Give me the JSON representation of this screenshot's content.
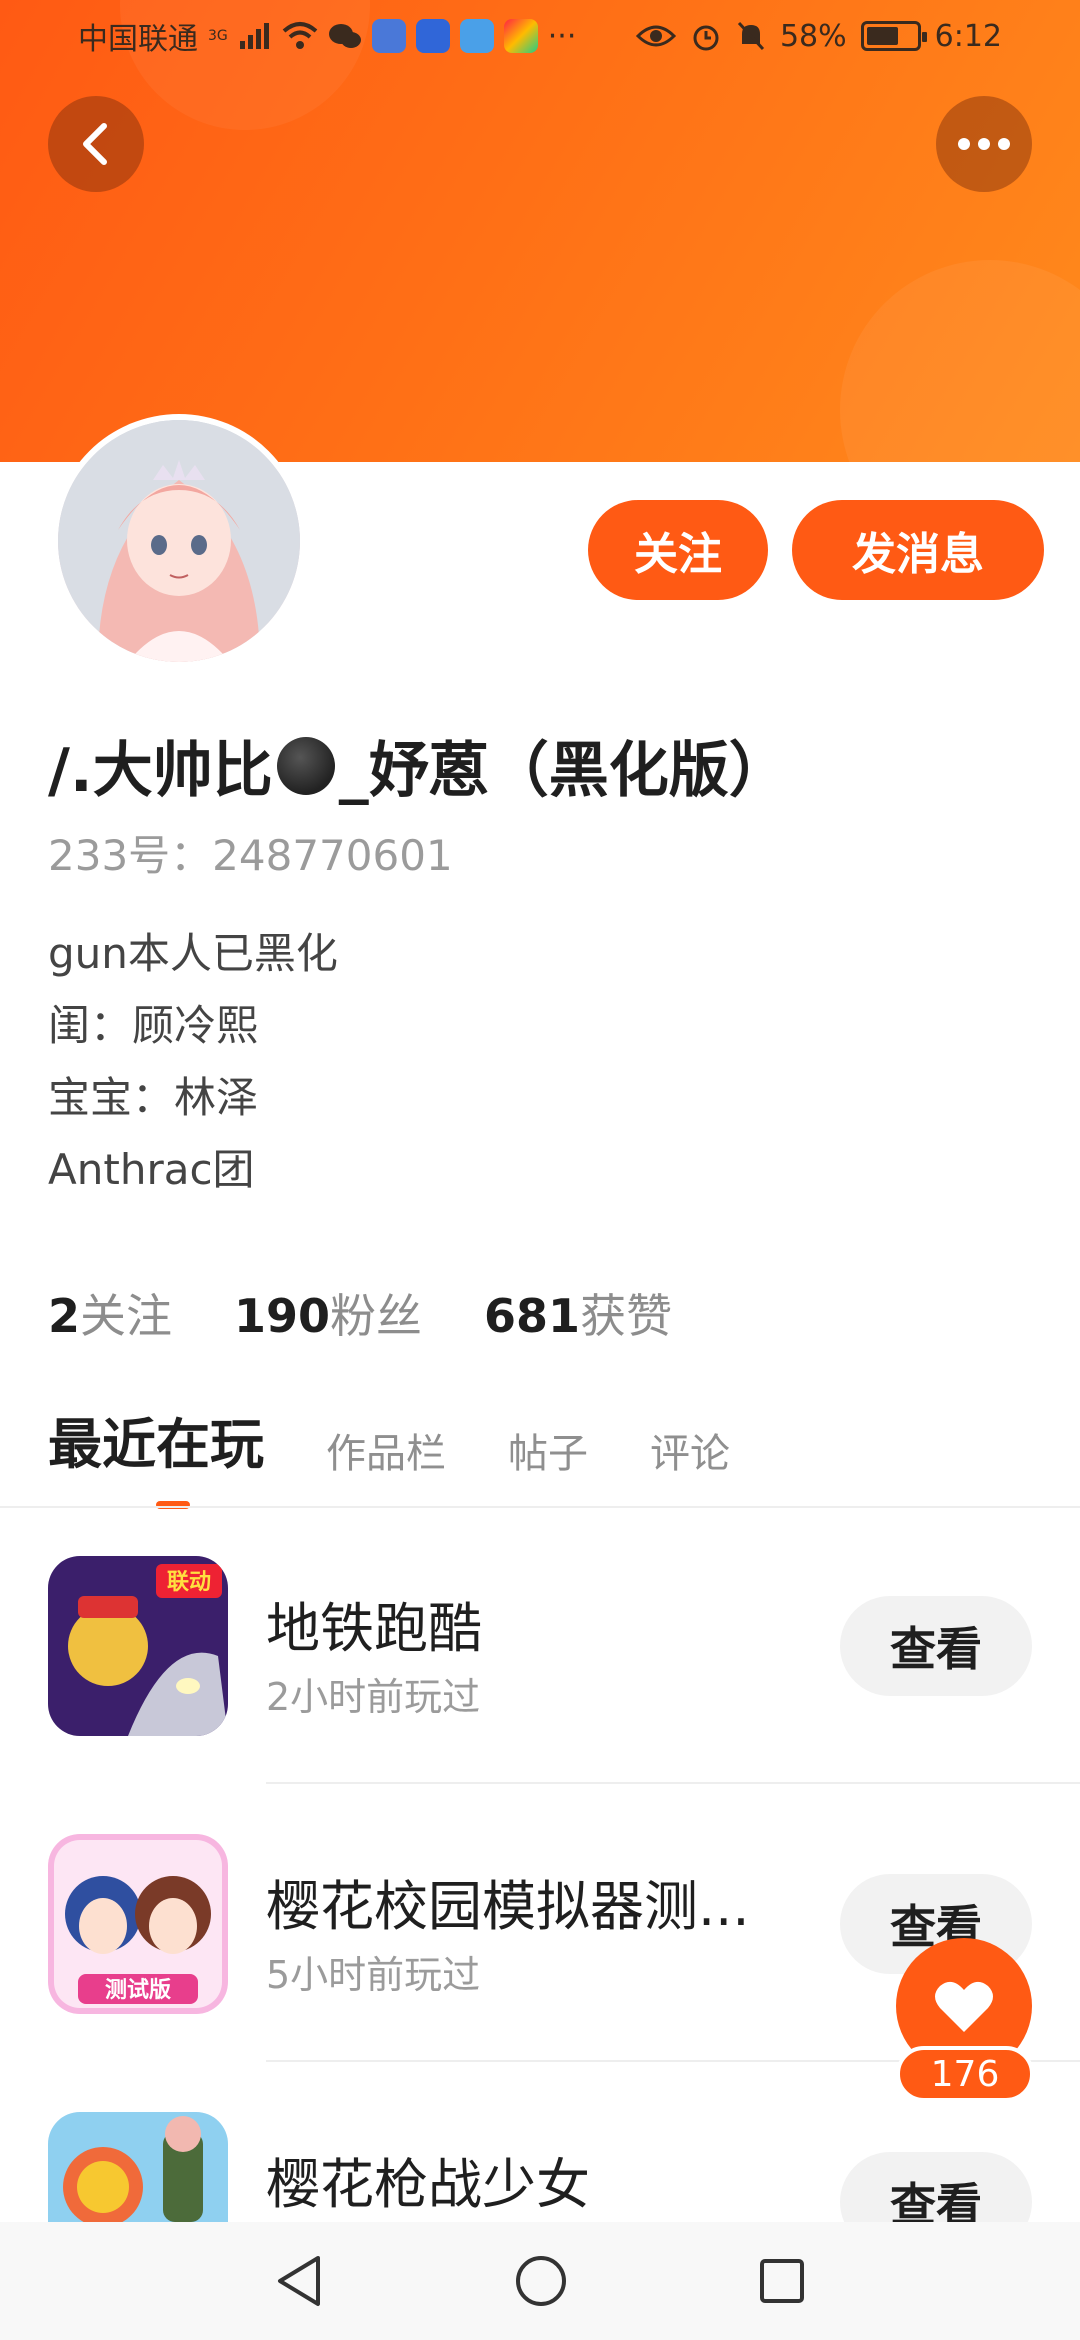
{
  "status_bar": {
    "carrier": "中国联通",
    "network": "3G",
    "battery": "58%",
    "time": "6:12"
  },
  "profile": {
    "username_prefix": "/.大帅比",
    "username_suffix": "_妤蒽（黑化版）",
    "id_line": "233号：248770601",
    "bio": [
      "gun本人已黑化",
      "闺：顾冷熙",
      "宝宝：林泽",
      "Anthrac团"
    ],
    "follow_label": "关注",
    "message_label": "发消息"
  },
  "stats": [
    {
      "value": "2",
      "label": "关注"
    },
    {
      "value": "190",
      "label": "粉丝"
    },
    {
      "value": "681",
      "label": "获赞"
    }
  ],
  "tabs": [
    "最近在玩",
    "作品栏",
    "帖子",
    "评论"
  ],
  "games": [
    {
      "name": "地铁跑酷",
      "time": "2小时前玩过",
      "button": "查看",
      "icon_badge": "联动"
    },
    {
      "name": "樱花校园模拟器测...",
      "time": "5小时前玩过",
      "button": "查看",
      "icon_badge": "测试版"
    },
    {
      "name": "樱花枪战少女",
      "time": "",
      "button": "查看",
      "icon_badge": ""
    }
  ],
  "like": {
    "count": "176"
  },
  "colors": {
    "accent": "#ff5a14",
    "header_start": "#ff5a14",
    "header_end": "#ff8a1c"
  }
}
